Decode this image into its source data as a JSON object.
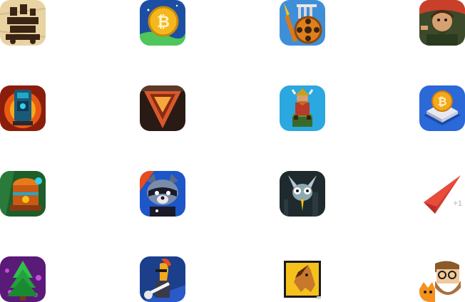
{
  "icons": [
    {
      "icon": "castle-tower-game-icon",
      "bg": "#e9d3a3",
      "accent": "#3a2414"
    },
    {
      "icon": "bitcoin-coin-game-icon",
      "bg": "#1c4fa3",
      "accent": "#f5b81c"
    },
    {
      "icon": "temple-wheel-game-icon",
      "bg": "#3f8fd8",
      "accent": "#e0801c"
    },
    {
      "icon": "bearded-warrior-game-icon",
      "bg": "#3b4a2a",
      "accent": "#d8a070"
    },
    {
      "icon": "machine-lava-game-icon",
      "bg": "#8a1e0c",
      "accent": "#1fa9c9"
    },
    {
      "icon": "lava-gem-game-icon",
      "bg": "#2a1a14",
      "accent": "#d8582a"
    },
    {
      "icon": "viking-tower-game-icon",
      "bg": "#2ba8e0",
      "accent": "#b83a28"
    },
    {
      "icon": "bitcoin-chip-game-icon",
      "bg": "#2b68d8",
      "accent": "#f5a81c"
    },
    {
      "icon": "treasure-chest-game-icon",
      "bg": "#1d5e2a",
      "accent": "#e87a1c"
    },
    {
      "icon": "raccoon-game-icon",
      "bg": "#1c56c8",
      "accent": "#7a8ca8"
    },
    {
      "icon": "bat-creature-game-icon",
      "bg": "#1e2a2e",
      "accent": "#8ea8b0"
    },
    {
      "icon": "red-paper-plane-game-icon",
      "bg": "#ffffff",
      "accent": "#e84c3c",
      "badge": "+1"
    },
    {
      "icon": "christmas-tree-game-icon",
      "bg": "#5a1a78",
      "accent": "#2fbf4a"
    },
    {
      "icon": "horse-guitar-game-icon",
      "bg": "#1c3f8c",
      "accent": "#f5a81c"
    },
    {
      "icon": "horse-head-game-icon",
      "bg": "#ffffff",
      "accent": "#f5c21c"
    },
    {
      "icon": "bearded-man-cat-game-icon",
      "bg": "#ffffff",
      "accent": "#f5901c"
    }
  ]
}
